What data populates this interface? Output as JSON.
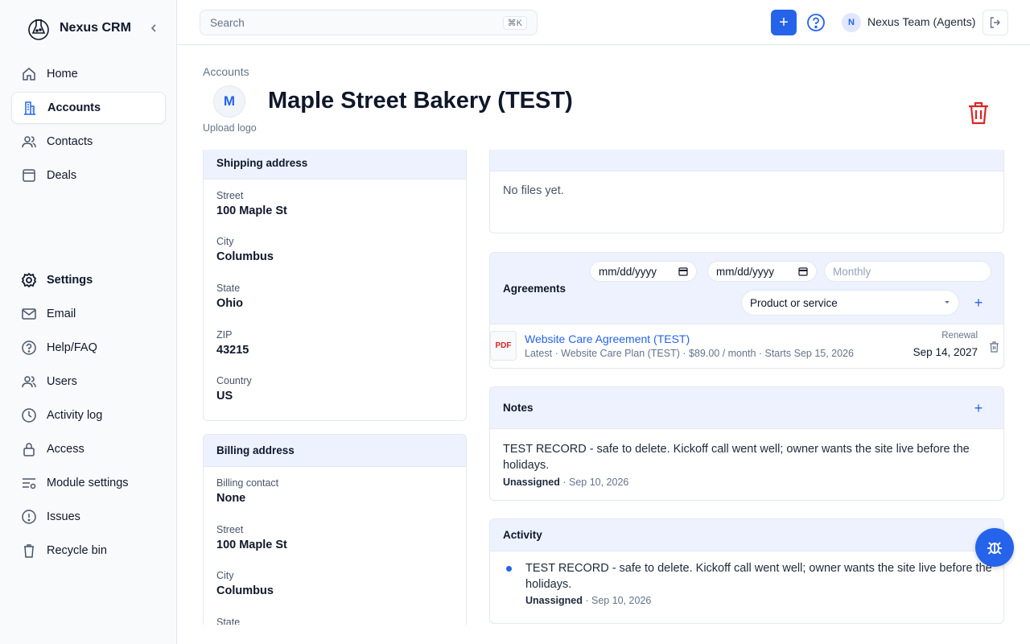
{
  "app": {
    "name": "Nexus CRM"
  },
  "sidebar": {
    "items": [
      {
        "label": "Home",
        "icon": "home-icon"
      },
      {
        "label": "Accounts",
        "icon": "building-icon",
        "active": true
      },
      {
        "label": "Contacts",
        "icon": "contacts-icon"
      },
      {
        "label": "Deals",
        "icon": "deals-icon"
      }
    ],
    "settings_heading": "Settings",
    "settings_items": [
      {
        "label": "Email",
        "icon": "mail-icon"
      },
      {
        "label": "Help/FAQ",
        "icon": "help-icon"
      },
      {
        "label": "Users",
        "icon": "users-icon"
      },
      {
        "label": "Activity log",
        "icon": "clock-icon"
      },
      {
        "label": "Access",
        "icon": "lock-icon"
      },
      {
        "label": "Module settings",
        "icon": "module-settings-icon"
      },
      {
        "label": "Issues",
        "icon": "alert-icon"
      },
      {
        "label": "Recycle bin",
        "icon": "trash-icon"
      }
    ]
  },
  "topbar": {
    "search_placeholder": "Search",
    "search_shortcut": "⌘K",
    "add_label": "+",
    "user_initial": "N",
    "user_name": "Nexus Team (Agents)"
  },
  "header": {
    "breadcrumb": "Accounts",
    "avatar_initial": "M",
    "upload_logo": "Upload logo",
    "title": "Maple Street Bakery (TEST)"
  },
  "shipping": {
    "title": "Shipping address",
    "fields": [
      {
        "label": "Street",
        "value": "100 Maple St"
      },
      {
        "label": "City",
        "value": "Columbus"
      },
      {
        "label": "State",
        "value": "Ohio"
      },
      {
        "label": "ZIP",
        "value": "43215"
      },
      {
        "label": "Country",
        "value": "US"
      }
    ]
  },
  "billing": {
    "title": "Billing address",
    "fields": [
      {
        "label": "Billing contact",
        "value": "None"
      },
      {
        "label": "Street",
        "value": "100 Maple St"
      },
      {
        "label": "City",
        "value": "Columbus"
      },
      {
        "label": "State",
        "value": ""
      }
    ]
  },
  "files": {
    "empty_text": "No files yet."
  },
  "agreements": {
    "title": "Agreements",
    "start_date_placeholder": "mm/dd/yyyy",
    "end_date_placeholder": "mm/dd/yyyy",
    "frequency_placeholder": "Monthly",
    "product_select": "Product or service",
    "items": [
      {
        "badge": "PDF",
        "name": "Website Care Agreement (TEST)",
        "details": "Latest · Website Care Plan (TEST) · $89.00 / month · Starts Sep 15, 2026",
        "renewal_label": "Renewal",
        "renewal_date": "Sep 14, 2027"
      }
    ]
  },
  "notes": {
    "title": "Notes",
    "items": [
      {
        "text": "TEST RECORD - safe to delete. Kickoff call went well; owner wants the site live before the holidays.",
        "author": "Unassigned",
        "date": "· Sep 10, 2026"
      }
    ]
  },
  "activity": {
    "title": "Activity",
    "items": [
      {
        "text": "TEST RECORD - safe to delete. Kickoff call went well; owner wants the site live before the holidays.",
        "author": "Unassigned",
        "date": "· Sep 10, 2026"
      }
    ]
  },
  "colors": {
    "accent": "#2563eb",
    "danger": "#dc2626",
    "card_header": "#eef2ff"
  }
}
